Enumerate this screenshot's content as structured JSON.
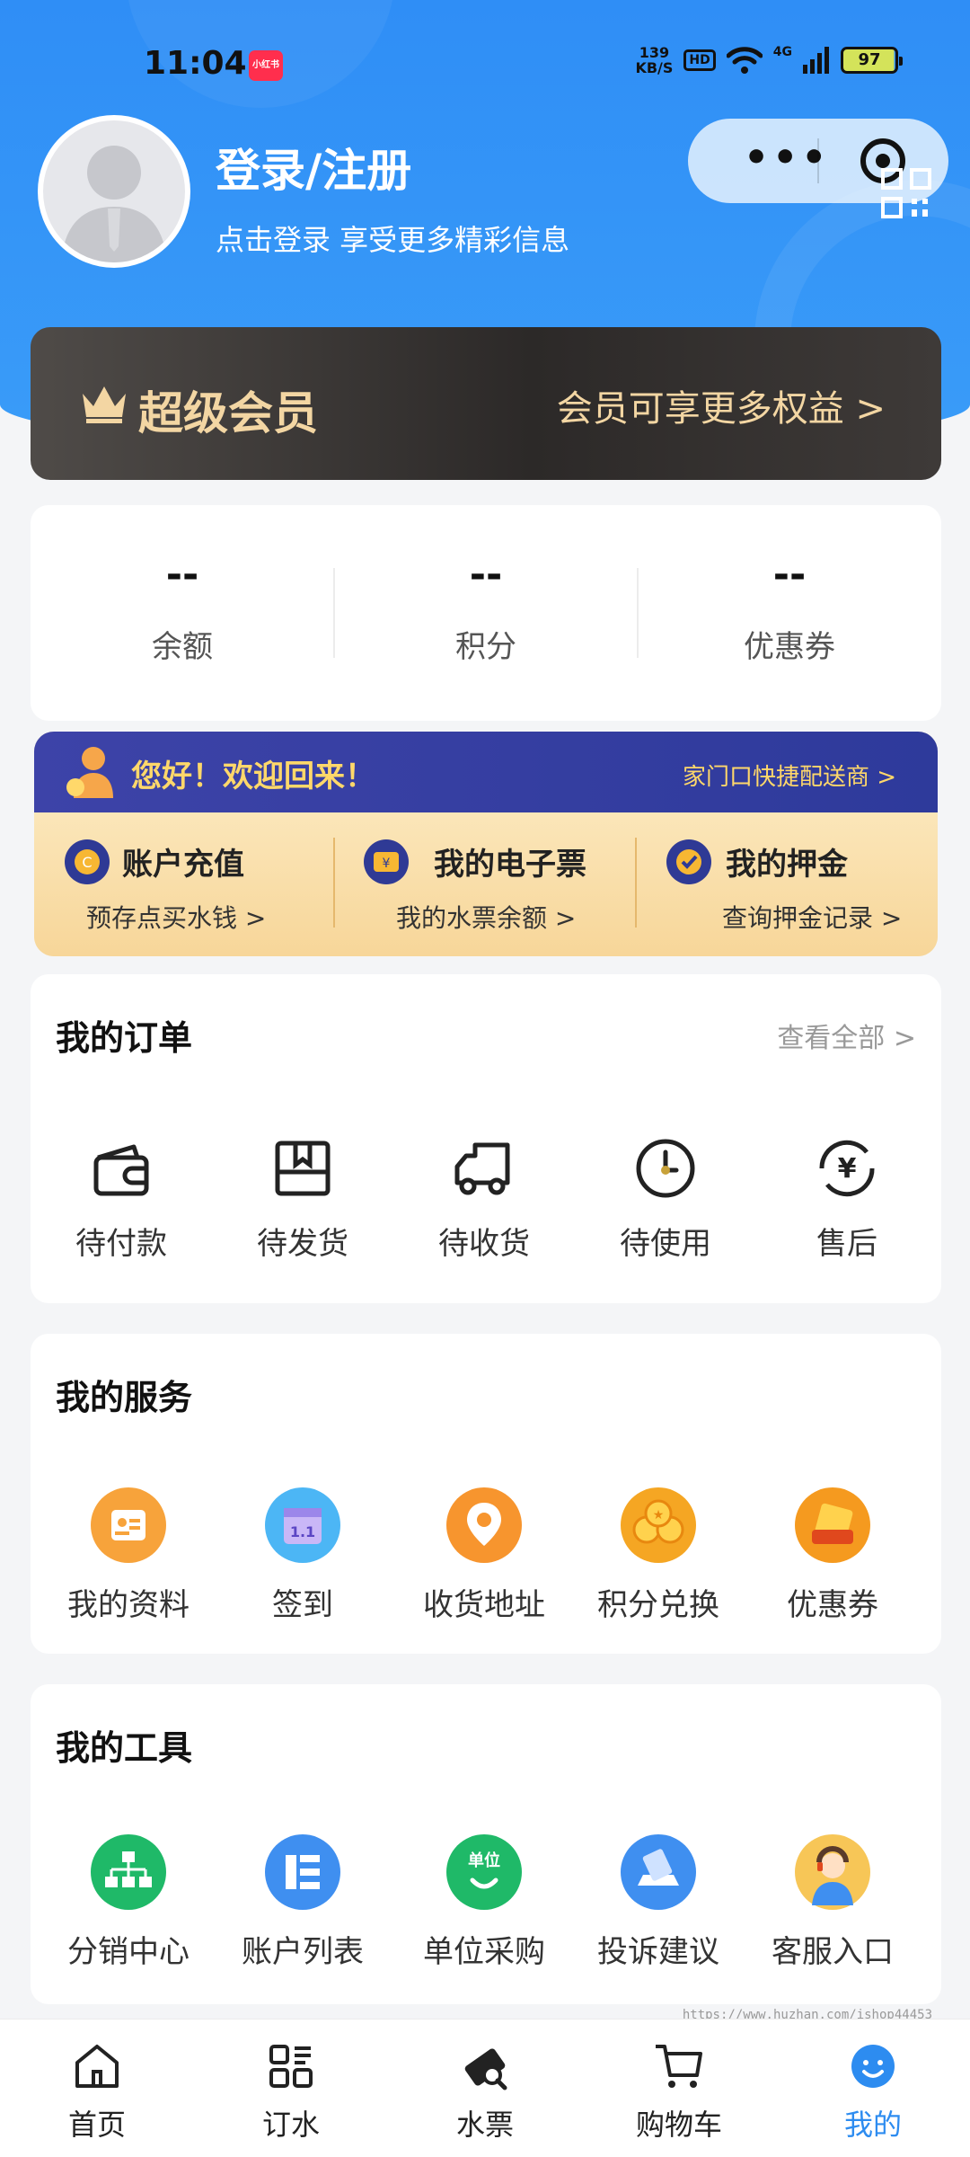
{
  "status_bar": {
    "time": "11:04",
    "badge": "小红书",
    "speed_top": "139",
    "speed_bottom": "KB/S",
    "hd": "HD",
    "network": "4G",
    "battery": "97"
  },
  "profile": {
    "title": "登录/注册",
    "subtitle": "点击登录 享受更多精彩信息"
  },
  "vip": {
    "title": "超级会员",
    "right_text": "会员可享更多权益 >"
  },
  "stats": [
    {
      "value": "--",
      "label": "余额"
    },
    {
      "value": "--",
      "label": "积分"
    },
    {
      "value": "--",
      "label": "优惠券"
    }
  ],
  "welcome": {
    "title": "您好！欢迎回来！",
    "right_text": "家门口快捷配送商 >",
    "items": [
      {
        "title": "账户充值",
        "sub": "预存点买水钱 >",
        "icon": "coin-icon"
      },
      {
        "title": "我的电子票",
        "sub": "我的水票余额 >",
        "icon": "ticket-icon"
      },
      {
        "title": "我的押金",
        "sub": "查询押金记录 >",
        "icon": "deposit-icon"
      }
    ]
  },
  "orders": {
    "title": "我的订单",
    "more": "查看全部 >",
    "items": [
      {
        "label": "待付款",
        "icon": "wallet-icon"
      },
      {
        "label": "待发货",
        "icon": "box-icon"
      },
      {
        "label": "待收货",
        "icon": "truck-icon"
      },
      {
        "label": "待使用",
        "icon": "clock-icon"
      },
      {
        "label": "售后",
        "icon": "refund-icon"
      }
    ]
  },
  "services": {
    "title": "我的服务",
    "items": [
      {
        "label": "我的资料",
        "icon": "profile-card-icon",
        "color": "#f7a33b"
      },
      {
        "label": "签到",
        "icon": "calendar-icon",
        "color": "#4cb6f5"
      },
      {
        "label": "收货地址",
        "icon": "location-icon",
        "color": "#f7952e"
      },
      {
        "label": "积分兑换",
        "icon": "coins-icon",
        "color": "#f5a623"
      },
      {
        "label": "优惠券",
        "icon": "coupon-icon",
        "color": "#f59a1f"
      }
    ]
  },
  "tools": {
    "title": "我的工具",
    "items": [
      {
        "label": "分销中心",
        "icon": "org-chart-icon",
        "color": "#1fb968"
      },
      {
        "label": "账户列表",
        "icon": "list-icon",
        "color": "#3f8ff0"
      },
      {
        "label": "单位采购",
        "icon": "bag-icon",
        "color": "#1fb968",
        "badge": "单位"
      },
      {
        "label": "投诉建议",
        "icon": "feedback-icon",
        "color": "#3f8ff0"
      },
      {
        "label": "客服入口",
        "icon": "support-agent-icon",
        "color": "#f7c657"
      }
    ]
  },
  "watermark": "https://www.huzhan.com/ishop44453",
  "tabbar": {
    "items": [
      {
        "label": "首页",
        "icon": "home-icon",
        "active": false
      },
      {
        "label": "订水",
        "icon": "grid-order-icon",
        "active": false
      },
      {
        "label": "水票",
        "icon": "water-ticket-icon",
        "active": false
      },
      {
        "label": "购物车",
        "icon": "cart-icon",
        "active": false
      },
      {
        "label": "我的",
        "icon": "smile-icon",
        "active": true
      }
    ],
    "active_color": "#2d8cf0"
  }
}
